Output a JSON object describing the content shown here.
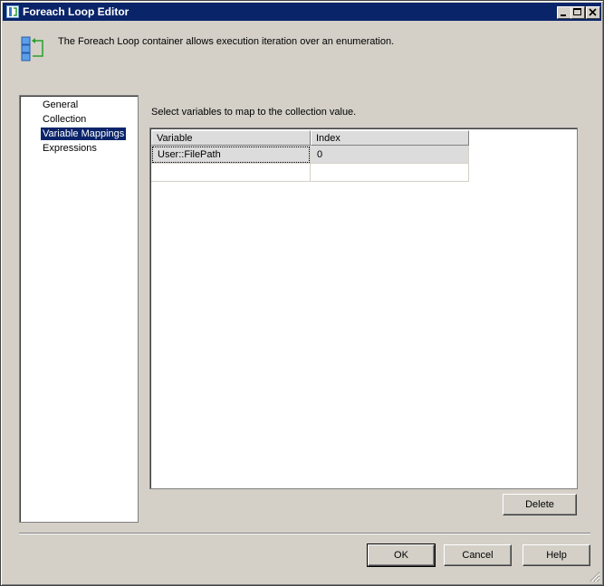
{
  "window": {
    "title": "Foreach Loop Editor",
    "controls": [
      "minimize-icon",
      "maximize-icon",
      "close-icon"
    ]
  },
  "description": {
    "icon": "foreach-loop-icon",
    "text": "The Foreach Loop container allows execution iteration over an enumeration."
  },
  "nav": {
    "items": [
      {
        "label": "General",
        "selected": false
      },
      {
        "label": "Collection",
        "selected": false
      },
      {
        "label": "Variable Mappings",
        "selected": true
      },
      {
        "label": "Expressions",
        "selected": false
      }
    ]
  },
  "mappings": {
    "instruction": "Select variables to map to the collection value.",
    "columns": [
      "Variable",
      "Index"
    ],
    "rows": [
      {
        "variable": "User::FilePath",
        "index": "0"
      },
      {
        "variable": "",
        "index": ""
      }
    ]
  },
  "buttons": {
    "delete": "Delete",
    "ok": "OK",
    "cancel": "Cancel",
    "help": "Help"
  },
  "colors": {
    "titlebar": "#0a246a",
    "face": "#d4d0c8",
    "selection": "#0a246a"
  }
}
